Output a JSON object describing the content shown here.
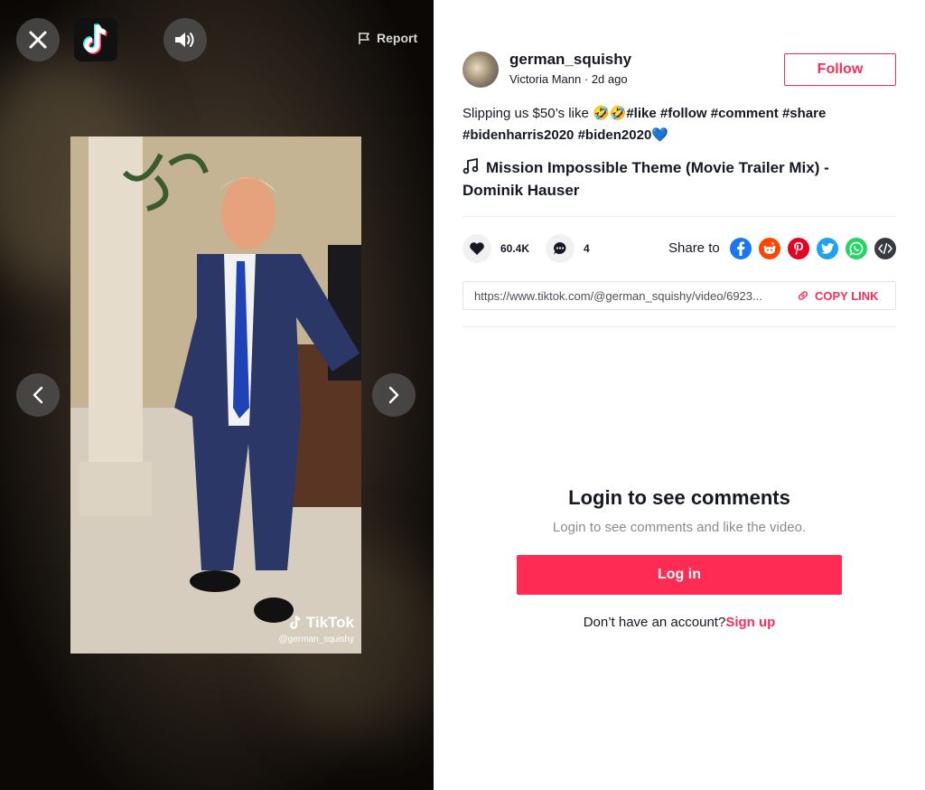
{
  "player": {
    "report_label": "Report",
    "watermark_brand": "TikTok",
    "watermark_user": "@german_squishy"
  },
  "author": {
    "username": "german_squishy",
    "display_name": "Victoria Mann",
    "time_ago": "2d ago",
    "separator": " · "
  },
  "follow_label": "Follow",
  "caption": {
    "text": "Slipping us $50’s like 🤣🤣",
    "hashtags": [
      "#like",
      "#follow",
      "#comment",
      "#share",
      "#bidenharris2020",
      "#biden2020"
    ],
    "suffix_emoji": "💙"
  },
  "music": {
    "title": "Mission Impossible Theme (Movie Trailer Mix) - Dominik Hauser"
  },
  "stats": {
    "likes": "60.4K",
    "comments": "4"
  },
  "share": {
    "label": "Share to",
    "targets": [
      "facebook-icon",
      "reddit-icon",
      "pinterest-icon",
      "twitter-icon",
      "whatsapp-icon",
      "embed-icon"
    ]
  },
  "link": {
    "url": "https://www.tiktok.com/@german_squishy/video/6923...",
    "copy_label": "COPY LINK"
  },
  "comments_gate": {
    "title": "Login to see comments",
    "subtitle": "Login to see comments and like the video.",
    "login_label": "Log in",
    "no_account_text": "Don’t have an account?",
    "signup_label": "Sign up"
  },
  "colors": {
    "accent": "#fe2c55",
    "facebook": "#1877f2",
    "reddit": "#ff4500",
    "pinterest": "#e60023",
    "twitter": "#1da1f2",
    "whatsapp": "#25d366",
    "embed": "#161823"
  }
}
